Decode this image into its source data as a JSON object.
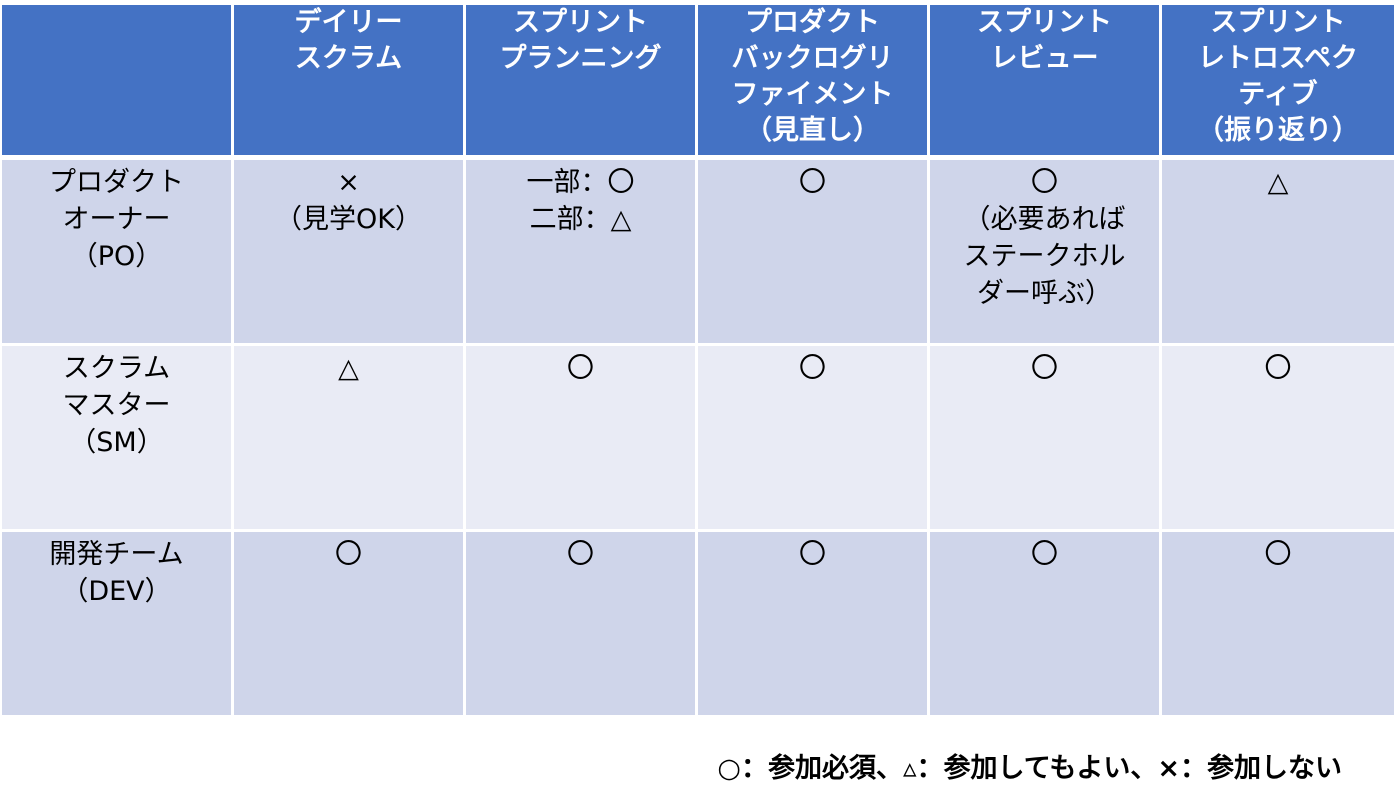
{
  "table": {
    "headers": [
      "",
      "デイリー\nスクラム",
      "スプリント\nプランニング",
      "プロダクト\nバックログリ\nファイメント\n（見直し）",
      "スプリント\nレビュー",
      "スプリント\nレトロスペク\nティブ\n（振り返り）"
    ],
    "rows": [
      {
        "role": "プロダクト\nオーナー\n（PO）",
        "cells": [
          "×\n（見学OK）",
          "一部：〇\n二部：△",
          "〇",
          "〇\n（必要あれば\nステークホル\nダー呼ぶ）",
          "△"
        ]
      },
      {
        "role": "スクラム\nマスター\n（SM）",
        "cells": [
          "△",
          "〇",
          "〇",
          "〇",
          "〇"
        ]
      },
      {
        "role": "開発チーム\n（DEV）",
        "cells": [
          "〇",
          "〇",
          "〇",
          "〇",
          "〇"
        ]
      }
    ]
  },
  "legend": "○：参加必須、▵：参加してもよい、×：参加しない",
  "colors": {
    "header": "#4472c4",
    "row_dark": "#cfd5ea",
    "row_light": "#e9ebf5"
  }
}
